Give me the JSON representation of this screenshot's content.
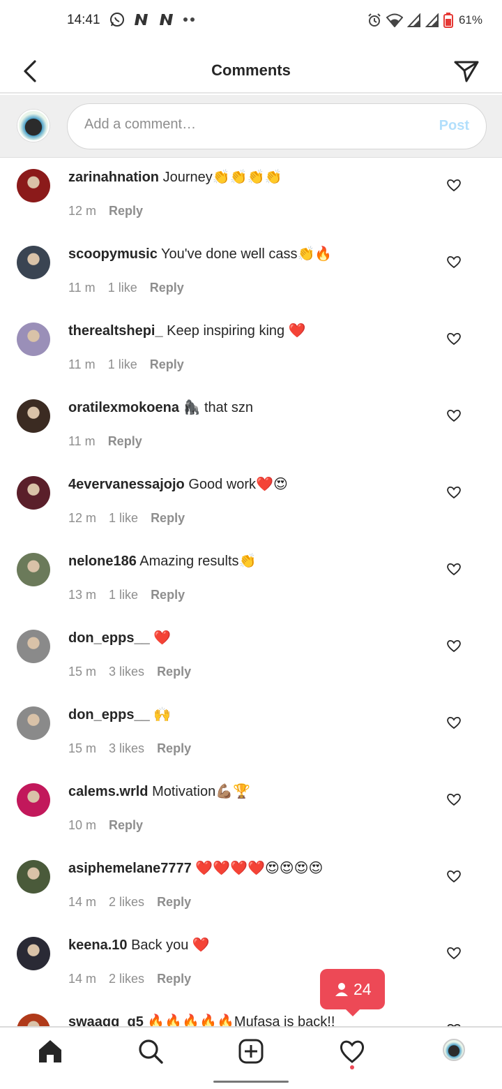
{
  "status_bar": {
    "time": "14:41",
    "battery": "61%",
    "icons": [
      "whatsapp-icon",
      "n-icon",
      "n-icon",
      "more-dots-icon",
      "alarm-icon",
      "wifi-icon",
      "signal-icon",
      "signal-icon",
      "battery-icon"
    ]
  },
  "header": {
    "title": "Comments",
    "back_icon": "chevron-left-icon",
    "share_icon": "paper-plane-icon"
  },
  "compose": {
    "placeholder": "Add a comment…",
    "post_label": "Post"
  },
  "comments": [
    {
      "user": "zarinahnation",
      "text": "Journey👏👏👏👏",
      "time": "12 m",
      "likes": "",
      "reply": "Reply",
      "avatar_color": "#8b1a1a"
    },
    {
      "user": "scoopymusic",
      "text": "You've done well cass👏🔥",
      "time": "11 m",
      "likes": "1 like",
      "reply": "Reply",
      "avatar_color": "#3a4452"
    },
    {
      "user": "therealtshepi_",
      "text": "Keep inspiring king ❤️",
      "time": "11 m",
      "likes": "1 like",
      "reply": "Reply",
      "avatar_color": "#9a8fb8"
    },
    {
      "user": "oratilexmokoena",
      "text": "🦍 that szn",
      "time": "11 m",
      "likes": "",
      "reply": "Reply",
      "avatar_color": "#3b2b22"
    },
    {
      "user": "4evervanessajojo",
      "text": "Good work❤️😍",
      "time": "12 m",
      "likes": "1 like",
      "reply": "Reply",
      "avatar_color": "#5a1f2a"
    },
    {
      "user": "nelone186",
      "text": "Amazing results👏",
      "time": "13 m",
      "likes": "1 like",
      "reply": "Reply",
      "avatar_color": "#6b7a5a"
    },
    {
      "user": "don_epps__",
      "text": "❤️",
      "time": "15 m",
      "likes": "3 likes",
      "reply": "Reply",
      "avatar_color": "#8a8a8a"
    },
    {
      "user": "don_epps__",
      "text": "🙌",
      "time": "15 m",
      "likes": "3 likes",
      "reply": "Reply",
      "avatar_color": "#8a8a8a"
    },
    {
      "user": "calems.wrld",
      "text": "Motivation💪🏽🏆",
      "time": "10 m",
      "likes": "",
      "reply": "Reply",
      "avatar_color": "#c2185b"
    },
    {
      "user": "asiphemelane7777",
      "text": "❤️❤️❤️❤️😍😍😍😍",
      "time": "14 m",
      "likes": "2 likes",
      "reply": "Reply",
      "avatar_color": "#4a5a3a"
    },
    {
      "user": "keena.10",
      "text": "Back you ❤️",
      "time": "14 m",
      "likes": "2 likes",
      "reply": "Reply",
      "avatar_color": "#2a2a35"
    },
    {
      "user": "swaagg_g5",
      "text": "🔥🔥🔥🔥🔥Mufasa is back!!",
      "time": "",
      "likes": "",
      "reply": "",
      "avatar_color": "#b03a1a"
    }
  ],
  "activity_badge": {
    "count": "24",
    "icon": "person-icon"
  },
  "bottom_nav": {
    "items": [
      "home-icon",
      "search-icon",
      "add-post-icon",
      "heart-icon",
      "profile-avatar"
    ]
  }
}
